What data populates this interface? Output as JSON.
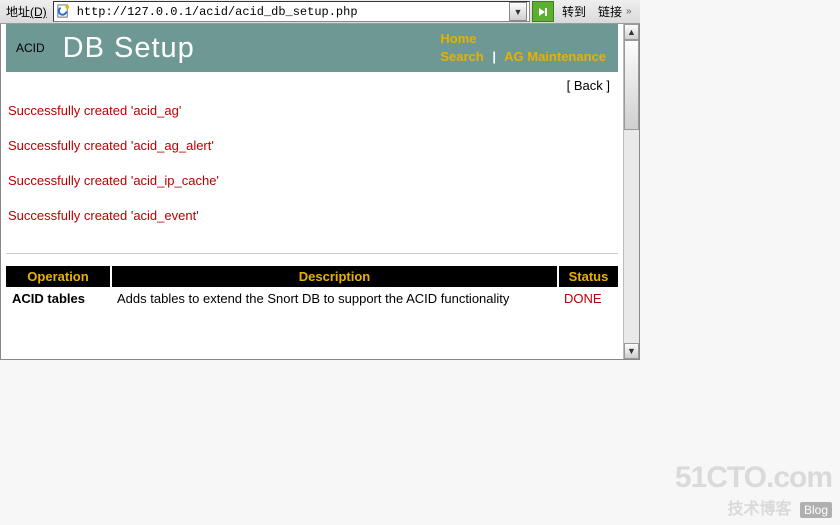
{
  "toolbar": {
    "address_label_pre": "地址",
    "address_label_hotkey": "(D)",
    "url": "http://127.0.0.1/acid/acid_db_setup.php",
    "go_label": "转到",
    "links_label": "链接"
  },
  "header": {
    "brand": "ACID",
    "title": "DB Setup",
    "nav": {
      "home": "Home",
      "search": "Search",
      "sep": "|",
      "ag": "AG Maintenance"
    }
  },
  "back_label": "[ Back ]",
  "messages": [
    "Successfully created 'acid_ag'",
    "Successfully created 'acid_ag_alert'",
    "Successfully created 'acid_ip_cache'",
    "Successfully created 'acid_event'"
  ],
  "table": {
    "headers": {
      "op": "Operation",
      "desc": "Description",
      "status": "Status"
    },
    "rows": [
      {
        "op": "ACID tables",
        "desc": "Adds tables to extend the Snort DB to support the ACID functionality",
        "status": "DONE"
      }
    ]
  },
  "watermark": {
    "brand": "51CTO.com",
    "tagline": "技术博客",
    "badge": "Blog"
  }
}
